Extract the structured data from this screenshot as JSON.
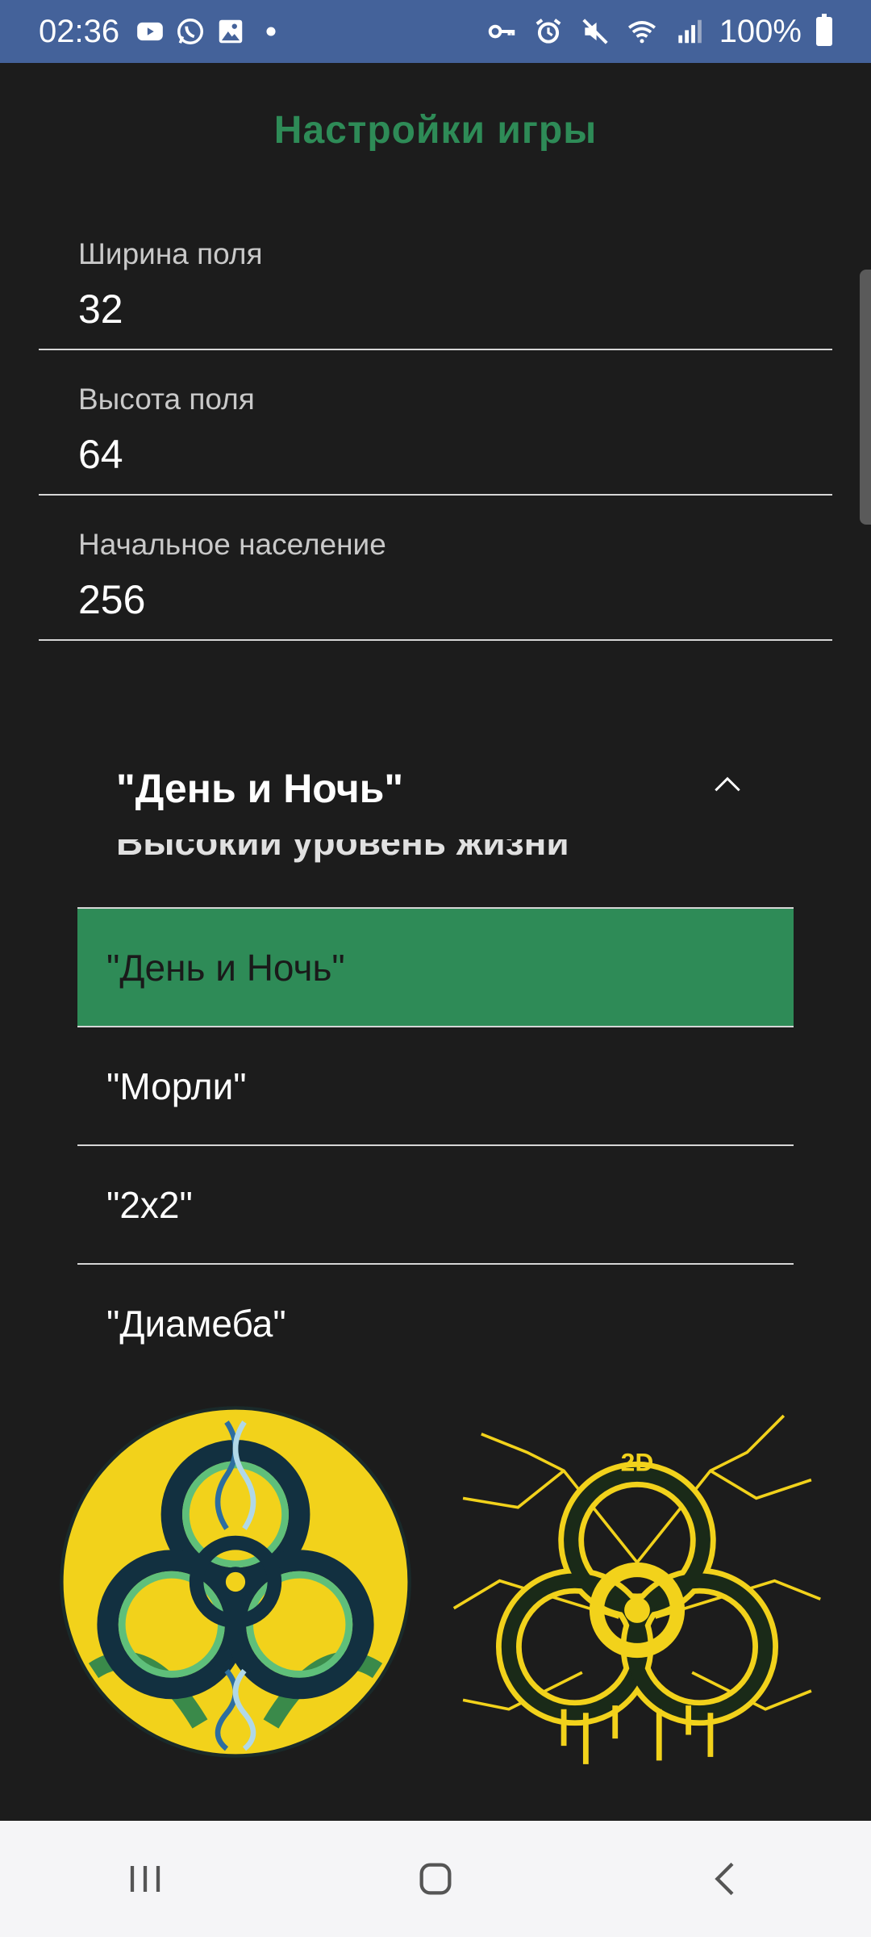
{
  "status_bar": {
    "time": "02:36",
    "battery_text": "100%",
    "left_icons": [
      "youtube-icon",
      "whatsapp-icon",
      "gallery-icon",
      "dot-icon"
    ],
    "right_icons": [
      "vpn-key-icon",
      "alarm-icon",
      "mute-icon",
      "wifi-icon",
      "signal-icon",
      "battery-icon"
    ]
  },
  "page": {
    "title": "Настройки игры"
  },
  "fields": [
    {
      "label": "Ширина поля",
      "value": "32"
    },
    {
      "label": "Высота поля",
      "value": "64"
    },
    {
      "label": "Начальное население",
      "value": "256"
    }
  ],
  "spinner": {
    "selected": "\"День и Ночь\""
  },
  "dropdown": {
    "partial_item": "Высокий уровень жизни",
    "items": [
      {
        "label": "\"День и Ночь\"",
        "selected": true
      },
      {
        "label": "\"Морли\"",
        "selected": false
      },
      {
        "label": "\"2x2\"",
        "selected": false
      },
      {
        "label": "\"Диамеба\"",
        "selected": false
      }
    ]
  },
  "emblems": {
    "right_badge_text": "2D"
  },
  "colors": {
    "accent": "#2e8b57",
    "status_bar": "#44629a",
    "background": "#1c1c1c",
    "nav_bar": "#f5f5f7",
    "emblem_yellow": "#f2d21b"
  },
  "nav_bar": {
    "buttons": [
      "recents-icon",
      "home-icon",
      "back-icon"
    ]
  }
}
